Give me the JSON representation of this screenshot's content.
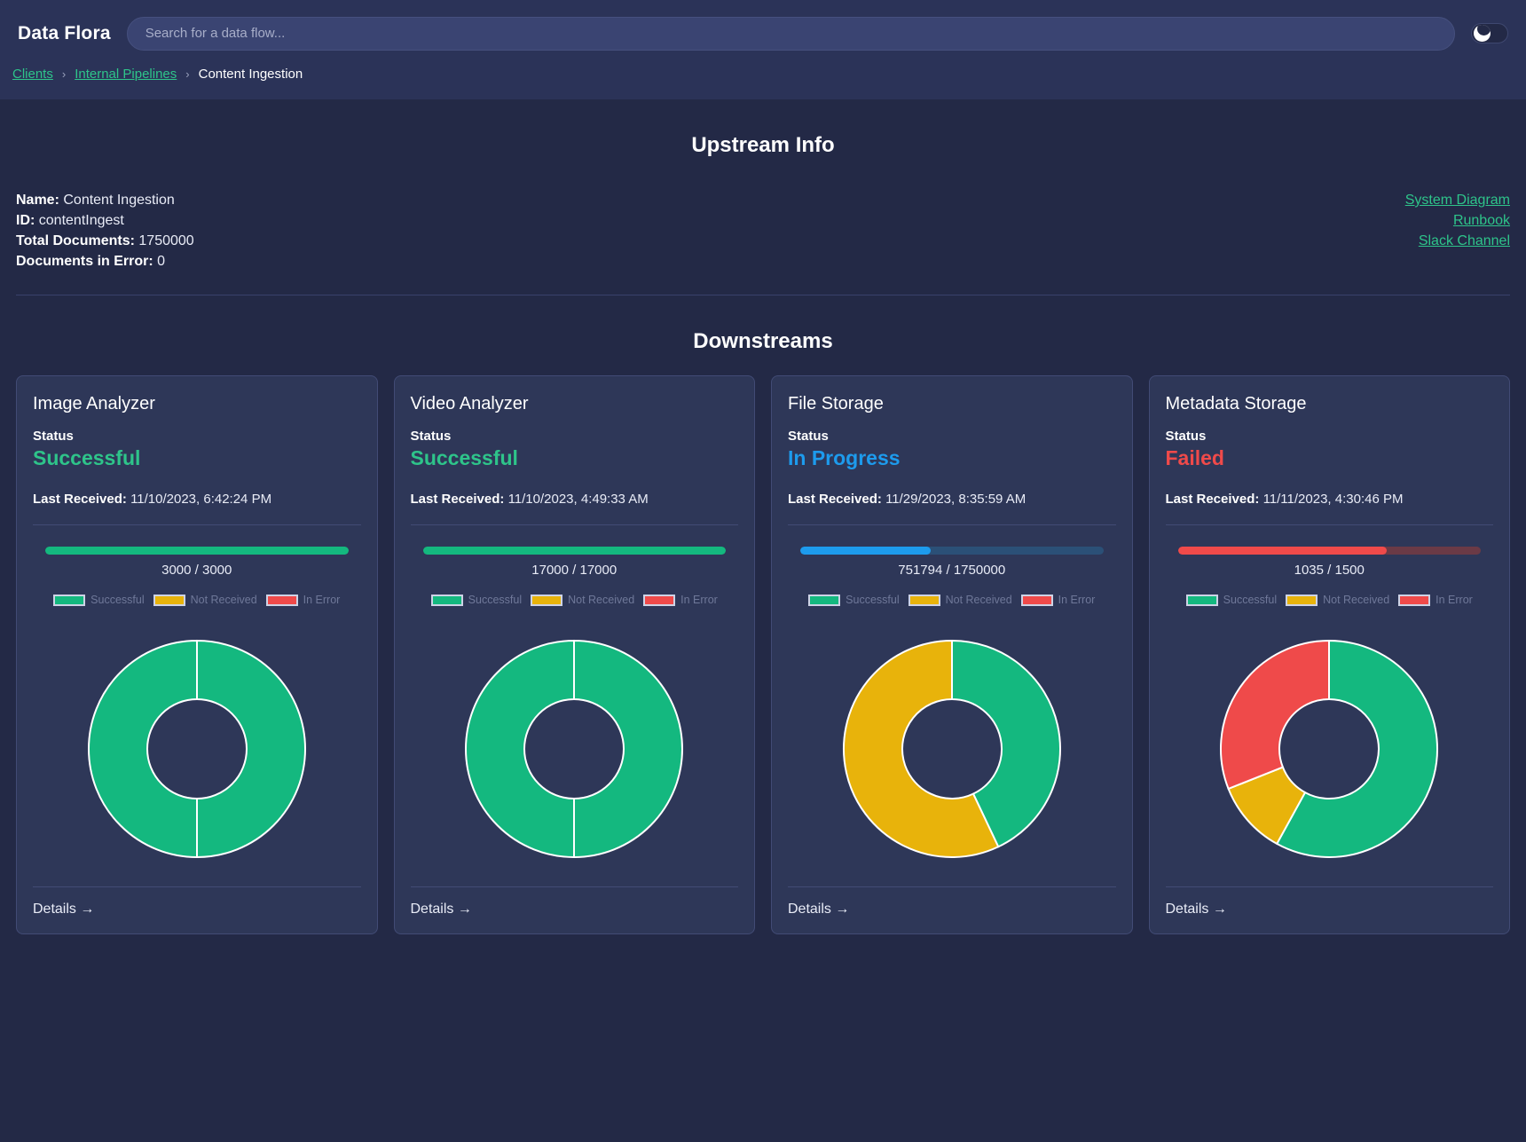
{
  "app": {
    "brand": "Data Flora",
    "theme_mode": "dark",
    "theme_icon": "moon-icon"
  },
  "search": {
    "placeholder": "Search for a data flow...",
    "value": ""
  },
  "breadcrumb": {
    "items": [
      {
        "label": "Clients",
        "link": true
      },
      {
        "label": "Internal Pipelines",
        "link": true
      },
      {
        "label": "Content Ingestion",
        "link": false
      }
    ],
    "separator": "›"
  },
  "upstream": {
    "title": "Upstream Info",
    "fields": [
      {
        "label": "Name:",
        "value": "Content Ingestion"
      },
      {
        "label": "ID:",
        "value": "contentIngest"
      },
      {
        "label": "Total Documents:",
        "value": "1750000"
      },
      {
        "label": "Documents in Error:",
        "value": "0"
      }
    ],
    "links": [
      {
        "label": "System Diagram"
      },
      {
        "label": "Runbook"
      },
      {
        "label": "Slack Channel"
      }
    ]
  },
  "downstreams": {
    "title": "Downstreams",
    "status_label": "Status",
    "last_received_label": "Last Received:",
    "details_label": "Details →",
    "legend": [
      {
        "label": "Successful",
        "color": "#14b87f"
      },
      {
        "label": "Not Received",
        "color": "#e8b30b"
      },
      {
        "label": "In Error",
        "color": "#ef4a4a"
      }
    ],
    "cards": [
      {
        "name": "Image Analyzer",
        "status": "Successful",
        "status_color": "#2ec48a",
        "last_received": "11/10/2023, 6:42:24 PM",
        "progress_text": "3000 / 3000",
        "progress_percent": 100,
        "progress_fill_color": "#14b87f",
        "progress_track_color": "#2b6a5b"
      },
      {
        "name": "Video Analyzer",
        "status": "Successful",
        "status_color": "#2ec48a",
        "last_received": "11/10/2023, 4:49:33 AM",
        "progress_text": "17000 / 17000",
        "progress_percent": 100,
        "progress_fill_color": "#14b87f",
        "progress_track_color": "#2b6a5b"
      },
      {
        "name": "File Storage",
        "status": "In Progress",
        "status_color": "#1d9bed",
        "last_received": "11/29/2023, 8:35:59 AM",
        "progress_text": "751794 / 1750000",
        "progress_percent": 43,
        "progress_fill_color": "#1d9bed",
        "progress_track_color": "#2b5077"
      },
      {
        "name": "Metadata Storage",
        "status": "Failed",
        "status_color": "#f04a4a",
        "last_received": "11/11/2023, 4:30:46 PM",
        "progress_text": "1035 / 1500",
        "progress_percent": 69,
        "progress_fill_color": "#f04a4a",
        "progress_track_color": "#6b3a46"
      }
    ]
  },
  "chart_data": [
    {
      "type": "pie",
      "title": "Image Analyzer",
      "labels": [
        "Successful",
        "Not Received",
        "In Error"
      ],
      "values": [
        3000,
        0,
        0
      ],
      "colors": [
        "#14b87f",
        "#e8b30b",
        "#ef4a4a"
      ],
      "total": 3000,
      "legend_position": "top"
    },
    {
      "type": "pie",
      "title": "Video Analyzer",
      "labels": [
        "Successful",
        "Not Received",
        "In Error"
      ],
      "values": [
        17000,
        0,
        0
      ],
      "colors": [
        "#14b87f",
        "#e8b30b",
        "#ef4a4a"
      ],
      "total": 17000,
      "legend_position": "top"
    },
    {
      "type": "pie",
      "title": "File Storage",
      "labels": [
        "Successful",
        "Not Received",
        "In Error"
      ],
      "values": [
        751794,
        998206,
        0
      ],
      "colors": [
        "#14b87f",
        "#e8b30b",
        "#ef4a4a"
      ],
      "total": 1750000,
      "legend_position": "top"
    },
    {
      "type": "pie",
      "title": "Metadata Storage",
      "labels": [
        "Successful",
        "Not Received",
        "In Error"
      ],
      "values": [
        870,
        165,
        465
      ],
      "colors": [
        "#14b87f",
        "#e8b30b",
        "#ef4a4a"
      ],
      "total": 1500,
      "legend_position": "top"
    }
  ]
}
